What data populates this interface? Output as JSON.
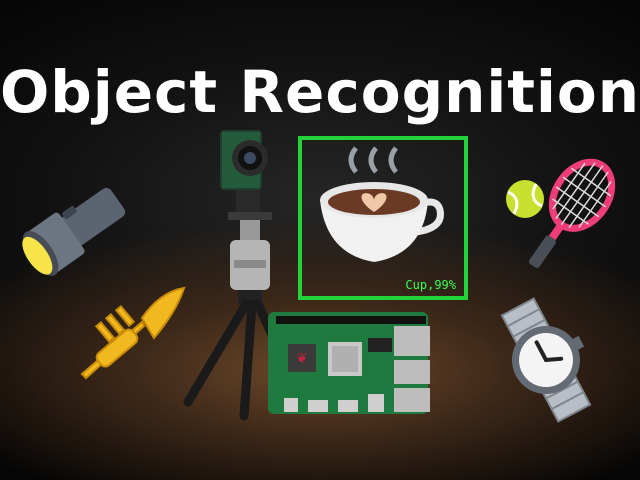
{
  "title": "Object Recognition",
  "detection": {
    "label": "Cup,99%"
  },
  "colors": {
    "detection_box": "#22d33a",
    "detection_text": "#39ff4a",
    "title": "#ffffff",
    "background": "#000000"
  },
  "icons": [
    "flashlight-icon",
    "trumpet-icon",
    "coffee-cup-icon",
    "tennis-racket-icon",
    "tennis-ball-icon",
    "wristwatch-icon",
    "camera-tripod-image",
    "raspberry-pi-board-image"
  ]
}
